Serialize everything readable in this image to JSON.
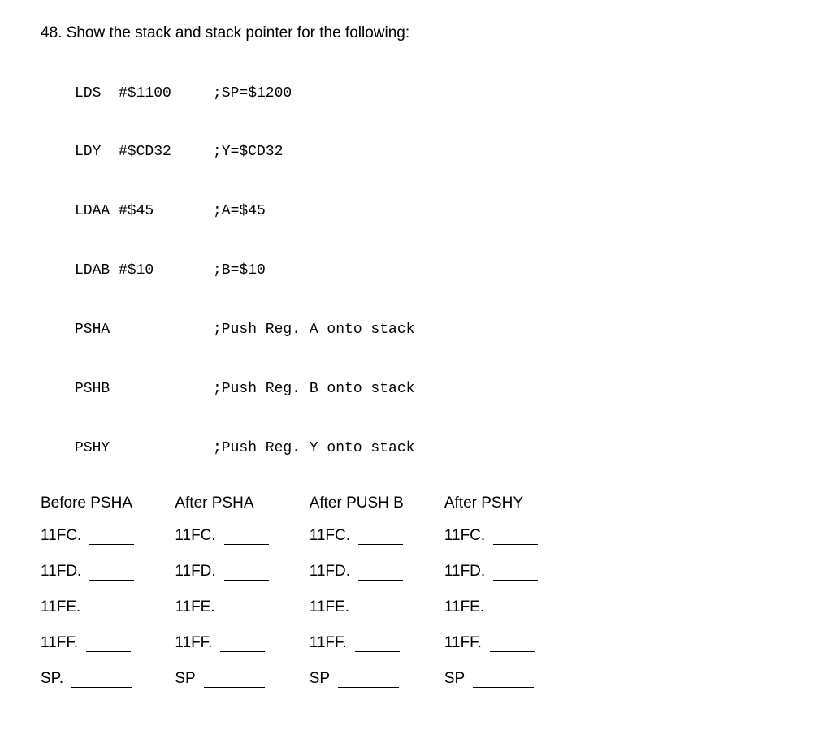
{
  "question": "48. Show the stack and stack pointer for the following:",
  "code": [
    {
      "instr": "LDS  #$1100",
      "comment": ";SP=$1200"
    },
    {
      "instr": "LDY  #$CD32",
      "comment": ";Y=$CD32"
    },
    {
      "instr": "LDAA #$45",
      "comment": ";A=$45"
    },
    {
      "instr": "LDAB #$10",
      "comment": ";B=$10"
    },
    {
      "instr": "PSHA",
      "comment": ";Push Reg. A onto stack"
    },
    {
      "instr": "PSHB",
      "comment": ";Push Reg. B onto stack"
    },
    {
      "instr": "PSHY",
      "comment": ";Push Reg. Y onto stack"
    }
  ],
  "columns": [
    {
      "header": "Before PSHA",
      "rows": [
        "11FC.",
        "11FD.",
        "11FE.",
        "11FF.",
        "SP."
      ]
    },
    {
      "header": "After PSHA",
      "rows": [
        "11FC.",
        "11FD.",
        "11FE.",
        "11FF.",
        "SP"
      ]
    },
    {
      "header": "After PUSH B",
      "rows": [
        "11FC.",
        "11FD.",
        "11FE.",
        "11FF.",
        "SP"
      ]
    },
    {
      "header": "After PSHY",
      "rows": [
        "11FC.",
        "11FD.",
        "11FE.",
        "11FF.",
        "SP"
      ]
    }
  ]
}
